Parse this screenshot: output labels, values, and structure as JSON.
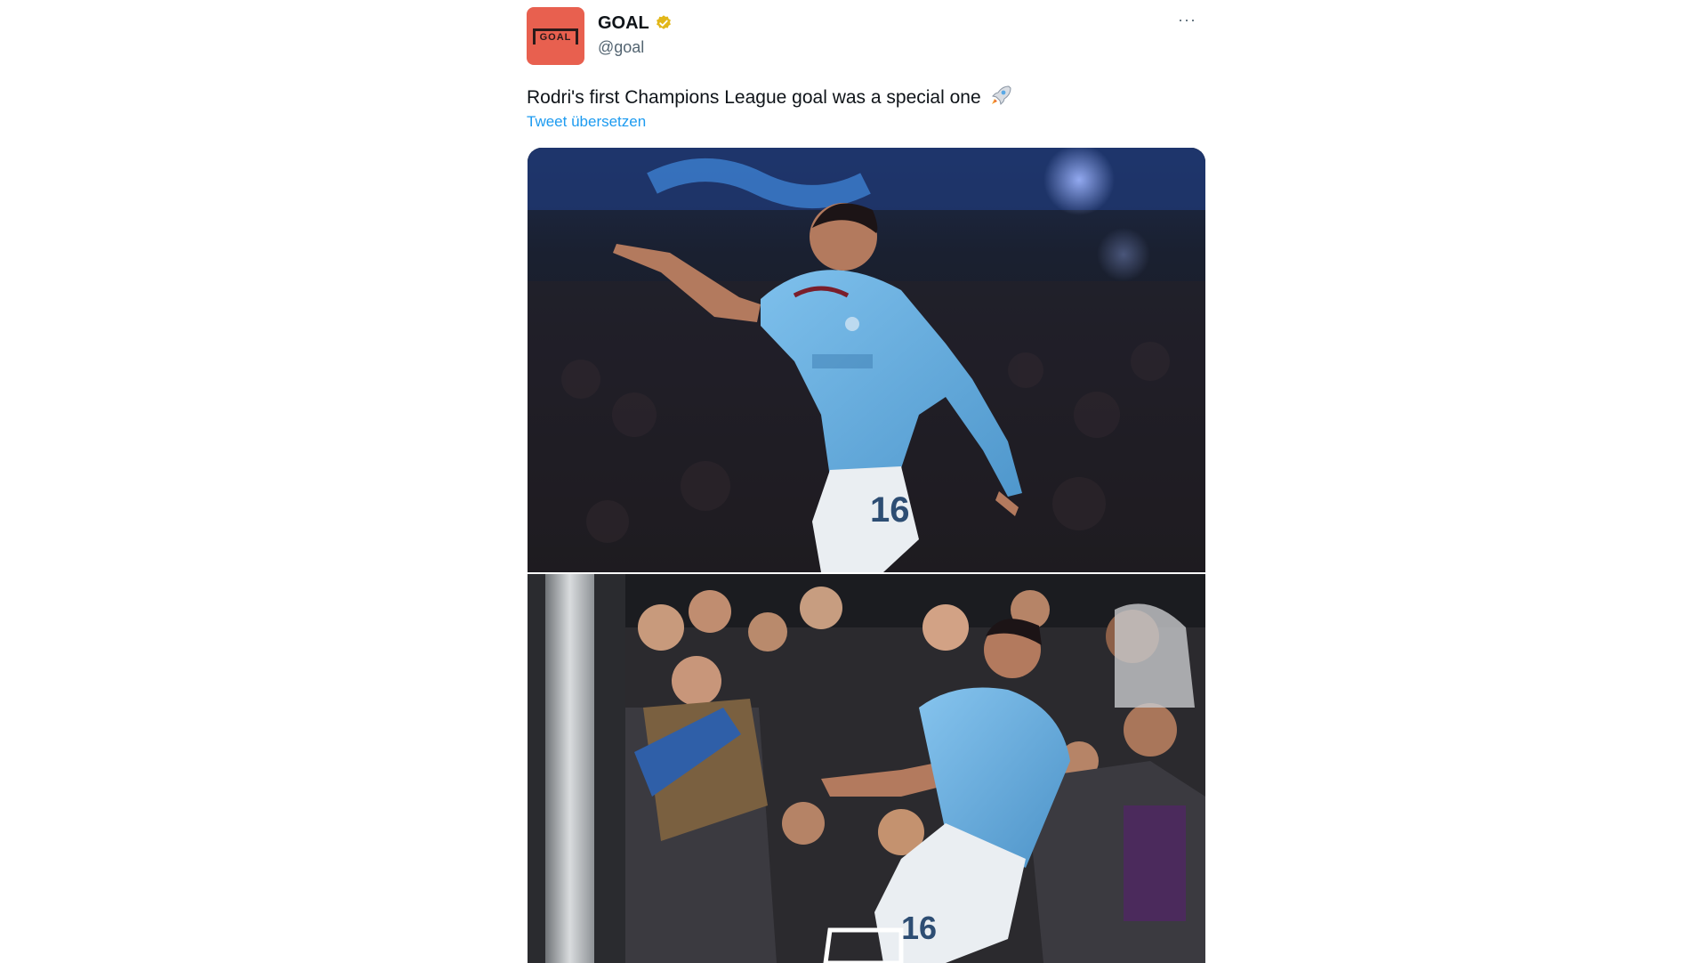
{
  "tweet": {
    "author": {
      "display_name": "GOAL",
      "handle": "@goal",
      "avatar_logo_text": "GOAL",
      "avatar_color": "#e8604f",
      "verified_badge_icon": "verified-gold-badge-icon",
      "verified_badge_color": "#e2b719"
    },
    "more_icon": "more-options-icon",
    "more_label": "···",
    "text": "Rodri's first Champions League goal was a special one",
    "text_emoji_icon": "rocket-icon",
    "translate_link": "Tweet übersetzen",
    "link_color": "#1d9bf0",
    "media": {
      "photos": [
        {
          "description_icon": "photo-celebration-pointing",
          "jersey_number": "16"
        },
        {
          "description_icon": "photo-celebration-crowd",
          "jersey_number": "16"
        }
      ],
      "jersey_color": "#6cabdd"
    }
  }
}
